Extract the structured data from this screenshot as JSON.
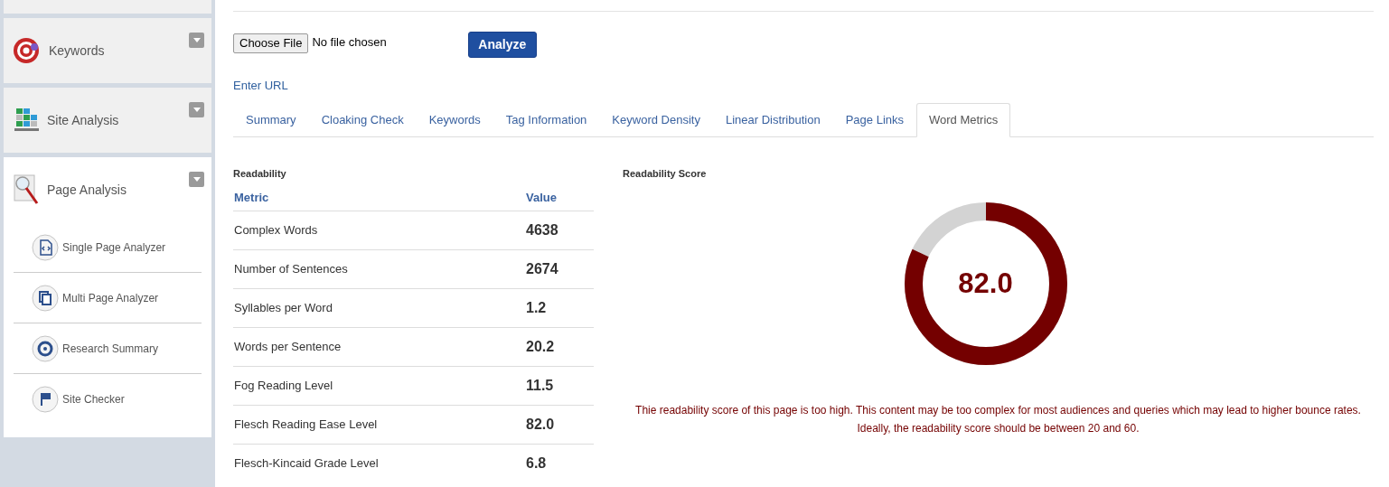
{
  "sidebar": {
    "sections": [
      {
        "kind": "keywords",
        "label": "Keywords",
        "expanded": false
      },
      {
        "kind": "site",
        "label": "Site Analysis",
        "expanded": false
      },
      {
        "kind": "page",
        "label": "Page Analysis",
        "expanded": true,
        "items": [
          {
            "kind": "code",
            "label": "Single Page Analyzer"
          },
          {
            "kind": "copy",
            "label": "Multi Page Analyzer"
          },
          {
            "kind": "target",
            "label": "Research Summary"
          },
          {
            "kind": "flag",
            "label": "Site Checker"
          }
        ]
      }
    ]
  },
  "file_input": {
    "button": "Choose File",
    "status": "No file chosen"
  },
  "analyze_button": "Analyze",
  "enter_url_link": "Enter URL",
  "tabs": [
    {
      "label": "Summary",
      "selected": false
    },
    {
      "label": "Cloaking Check",
      "selected": false
    },
    {
      "label": "Keywords",
      "selected": false
    },
    {
      "label": "Tag Information",
      "selected": false
    },
    {
      "label": "Keyword Density",
      "selected": false
    },
    {
      "label": "Linear Distribution",
      "selected": false
    },
    {
      "label": "Page Links",
      "selected": false
    },
    {
      "label": "Word Metrics",
      "selected": true
    }
  ],
  "readability": {
    "title": "Readability",
    "columns": [
      "Metric",
      "Value"
    ],
    "rows": [
      {
        "metric": "Complex Words",
        "value": "4638"
      },
      {
        "metric": "Number of Sentences",
        "value": "2674"
      },
      {
        "metric": "Syllables per Word",
        "value": "1.2"
      },
      {
        "metric": "Words per Sentence",
        "value": "20.2"
      },
      {
        "metric": "Fog Reading Level",
        "value": "11.5"
      },
      {
        "metric": "Flesch Reading Ease Level",
        "value": "82.0"
      },
      {
        "metric": "Flesch-Kincaid Grade Level",
        "value": "6.8"
      }
    ]
  },
  "score": {
    "title": "Readability Score",
    "value": "82.0",
    "level": 0.82,
    "message": "Thie readability score of this page is too high. This content may be too complex for most audiences and queries which may lead to higher bounce rates. Ideally, the readability score should be between 20 and 60."
  }
}
